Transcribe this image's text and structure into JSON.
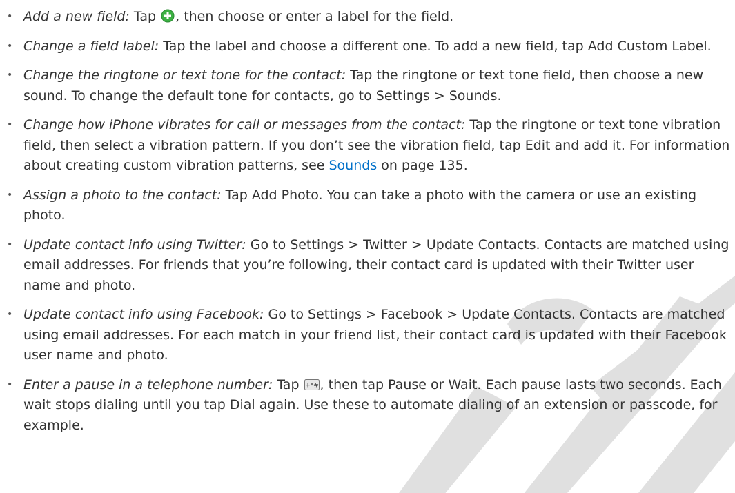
{
  "bullet_char": "•",
  "colors": {
    "link": "#0070c9",
    "plus_icon": "#3cb043",
    "watermark": "#e0e0e0"
  },
  "items": [
    {
      "lead": "Add a new field:",
      "before": " Tap ",
      "icon": "plus-circle-icon",
      "after": ", then choose or enter a label for the field."
    },
    {
      "lead": "Change a field label:",
      "text": " Tap the label and choose a different one. To add a new field, tap Add Custom Label."
    },
    {
      "lead": "Change the ringtone or text tone for the contact:",
      "text": " Tap the ringtone or text tone field, then choose a new sound. To change the default tone for contacts, go to Settings > Sounds."
    },
    {
      "lead": "Change how iPhone vibrates for call or messages from the contact:",
      "text": " Tap the ringtone or text tone vibration field, then select a vibration pattern. If you don’t see the vibration field, tap Edit and add it. For information about creating custom vibration patterns, see ",
      "link": "Sounds",
      "after": " on page 135."
    },
    {
      "lead": "Assign a photo to the contact:",
      "text": " Tap Add Photo. You can take a photo with the camera or use an existing photo."
    },
    {
      "lead": "Update contact info using Twitter:",
      "text": " Go to Settings > Twitter > Update Contacts. Contacts are matched using email addresses. For friends that you’re following, their contact card is updated with their Twitter user name and photo."
    },
    {
      "lead": "Update contact info using Facebook:",
      "text": " Go to Settings > Facebook > Update Contacts. Contacts are matched using email addresses. For each match in your friend list, their contact card is updated with their Facebook user name and photo."
    },
    {
      "lead": "Enter a pause in a telephone number:",
      "before": " Tap ",
      "icon": "keypad-symbols-icon",
      "after": ", then tap Pause or Wait. Each pause lasts two seconds. Each wait stops dialing until you tap Dial again. Use these to automate dialing of an extension or passcode, for example."
    }
  ]
}
